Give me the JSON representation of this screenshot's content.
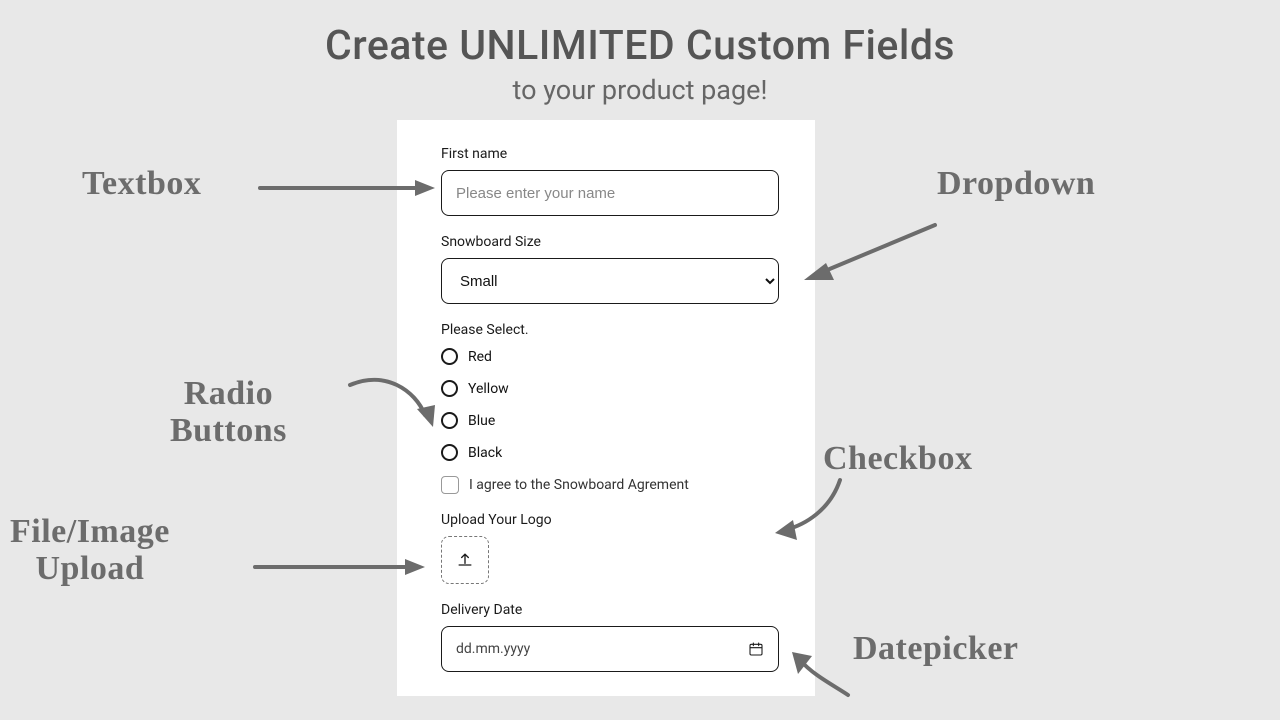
{
  "heading": {
    "title": "Create UNLIMITED Custom Fields",
    "subtitle": "to your product page!"
  },
  "form": {
    "first_name": {
      "label": "First name",
      "placeholder": "Please enter your name"
    },
    "size": {
      "label": "Snowboard Size",
      "selected": "Small"
    },
    "color": {
      "label": "Please Select.",
      "options": {
        "0": "Red",
        "1": "Yellow",
        "2": "Blue",
        "3": "Black"
      }
    },
    "agree": {
      "label": "I agree to the Snowboard Agrement"
    },
    "upload": {
      "label": "Upload Your Logo"
    },
    "date": {
      "label": "Delivery Date",
      "placeholder": "dd.mm.yyyy"
    }
  },
  "annotations": {
    "textbox": "Textbox",
    "dropdown": "Dropdown",
    "radio_line1": "Radio",
    "radio_line2": "Buttons",
    "checkbox": "Checkbox",
    "upload_line1": "File/Image",
    "upload_line2": "Upload",
    "date": "Datepicker"
  }
}
